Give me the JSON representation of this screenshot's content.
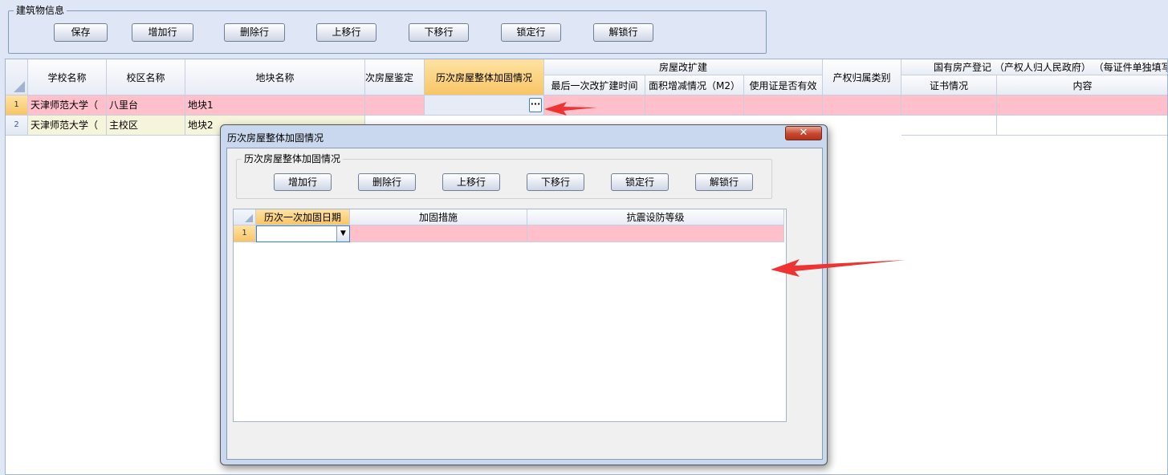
{
  "building_info": {
    "legend": "建筑物信息",
    "buttons": [
      "保存",
      "增加行",
      "删除行",
      "上移行",
      "下移行",
      "锁定行",
      "解锁行"
    ]
  },
  "main_grid": {
    "columns": {
      "school": "学校名称",
      "campus": "校区名称",
      "plot": "地块名称",
      "appraisal": "次房屋鉴定",
      "reinforce": "历次房屋整体加固情况",
      "expansion_group": "房屋改扩建",
      "last_expansion": "最后一次改扩建时间",
      "area_change": "面积增减情况（M2）",
      "permit_valid": "使用证是否有效",
      "ownership": "产权归属类别",
      "registration_group": "国有房产登记  （产权人归人民政府）  （每证件单独填写",
      "certificate": "证书情况",
      "content": "内容"
    },
    "rows": [
      {
        "num": "1",
        "school": "天津师范大学（",
        "campus": "八里台",
        "plot": "地块1",
        "reinforce_btn": "···"
      },
      {
        "num": "2",
        "school": "天津师范大学（",
        "campus": "主校区",
        "plot": "地块2"
      }
    ]
  },
  "dialog": {
    "title": "历次房屋整体加固情况",
    "close": "✕",
    "group_legend": "历次房屋整体加固情况",
    "buttons": [
      "增加行",
      "删除行",
      "上移行",
      "下移行",
      "锁定行",
      "解锁行"
    ],
    "columns": [
      "历次一次加固日期",
      "加固措施",
      "抗震设防等级"
    ],
    "rows": [
      {
        "num": "1",
        "date": "",
        "measure": "",
        "level": ""
      }
    ]
  },
  "colors": {
    "selected_row": "#ffc0cb",
    "alt_row": "#f5f5dc",
    "selected_header": "#f8c565",
    "annotation_arrow": "#ee3333"
  }
}
